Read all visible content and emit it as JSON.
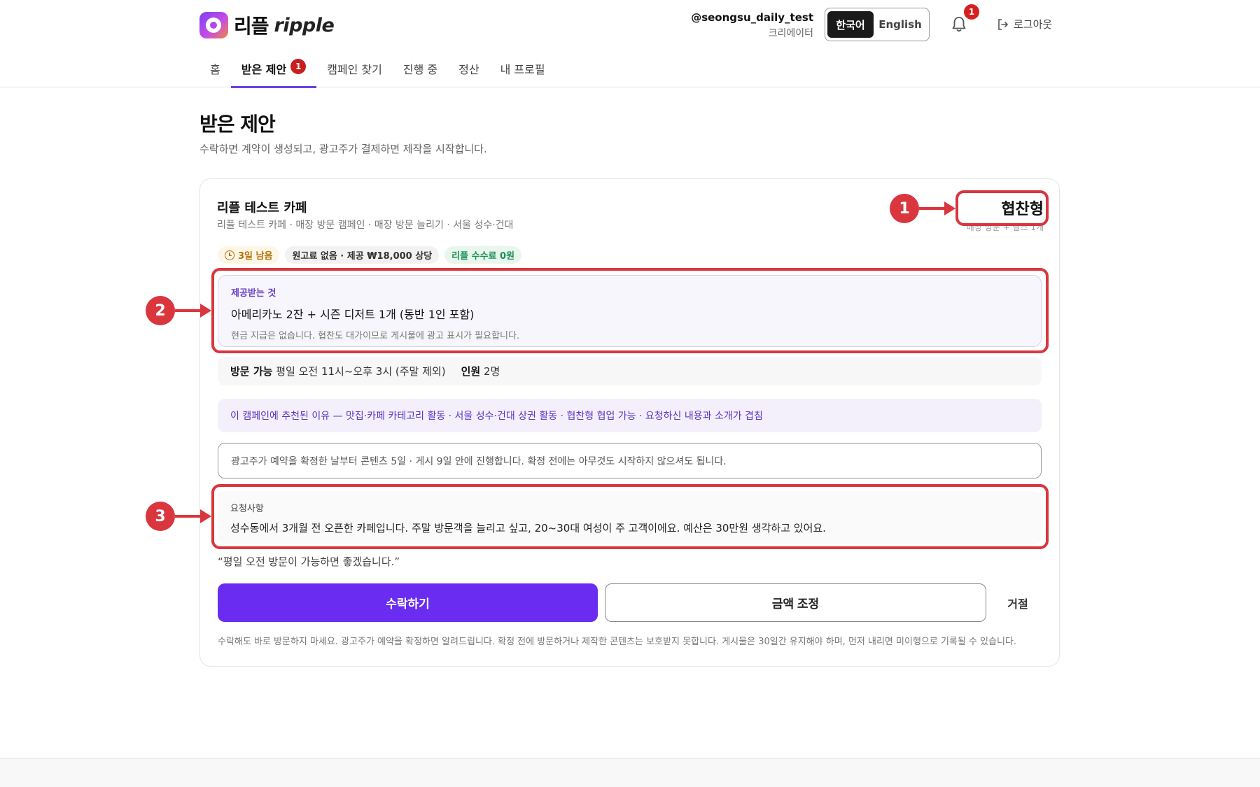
{
  "header": {
    "logo_ko": "리플",
    "logo_en": "ripple",
    "user_handle": "@seongsu_daily_test",
    "user_role": "크리에이터",
    "lang_ko": "한국어",
    "lang_en": "English",
    "notification_count": "1",
    "logout_label": "로그아웃"
  },
  "nav": {
    "items": [
      {
        "label": "홈"
      },
      {
        "label": "받은 제안",
        "badge": "1"
      },
      {
        "label": "캠페인 찾기"
      },
      {
        "label": "진행 중"
      },
      {
        "label": "정산"
      },
      {
        "label": "내 프로필"
      }
    ]
  },
  "page": {
    "title": "받은 제안",
    "subtitle": "수락하면 계약이 생성되고, 광고주가 결제하면 제작을 시작합니다."
  },
  "offer": {
    "store_name": "리플 테스트 카페",
    "store_meta": "리플 테스트 카페 · 매장 방문 캠페인 · 매장 방문 늘리기 · 서울 성수·건대",
    "type_label": "협찬형",
    "type_sub": "매장 방문 + 릴스 1개",
    "chips": {
      "time_left": "3일 남음",
      "fee": "원고료 없음 · 제공 ₩18,000 상당",
      "ripple_fee": "리플 수수료 0원"
    },
    "provide": {
      "title": "제공받는 것",
      "main": "아메리카노 2잔 + 시즌 디저트 1개 (동반 1인 포함)",
      "note": "현금 지급은 없습니다. 협찬도 대가이므로 게시물에 광고 표시가 필요합니다."
    },
    "visit": {
      "label": "방문 가능",
      "value": "평일 오전 11시~오후 3시 (주말 제외)",
      "people_label": "인원",
      "people_value": "2명"
    },
    "reason": "이 캠페인에 추천된 이유 — 맛집·카페 카테고리 활동 · 서울 성수·건대 상권 활동 · 협찬형 협업 가능 · 요청하신 내용과 소개가 겹침",
    "schedule": "광고주가 예약을 확정한 날부터 콘텐츠 5일 · 게시 9일 안에 진행합니다. 확정 전에는 아무것도 시작하지 않으셔도 됩니다.",
    "request": {
      "title": "요청사항",
      "text": "성수동에서 3개월 전 오픈한 카페입니다. 주말 방문객을 늘리고 싶고, 20~30대 여성이 주 고객이에요. 예산은 30만원 생각하고 있어요."
    },
    "quote": "“평일 오전 방문이 가능하면 좋겠습니다.”",
    "actions": {
      "accept": "수락하기",
      "adjust": "금액 조정",
      "reject": "거절"
    },
    "footnote": "수락해도 바로 방문하지 마세요. 광고주가 예약을 확정하면 알려드립니다. 확정 전에 방문하거나 제작한 콘텐츠는 보호받지 못합니다. 게시물은 30일간 유지해야 하며, 먼저 내리면 미이행으로 기록될 수 있습니다."
  },
  "annotations": {
    "marker_1": "1",
    "marker_2": "2",
    "marker_3": "3"
  }
}
